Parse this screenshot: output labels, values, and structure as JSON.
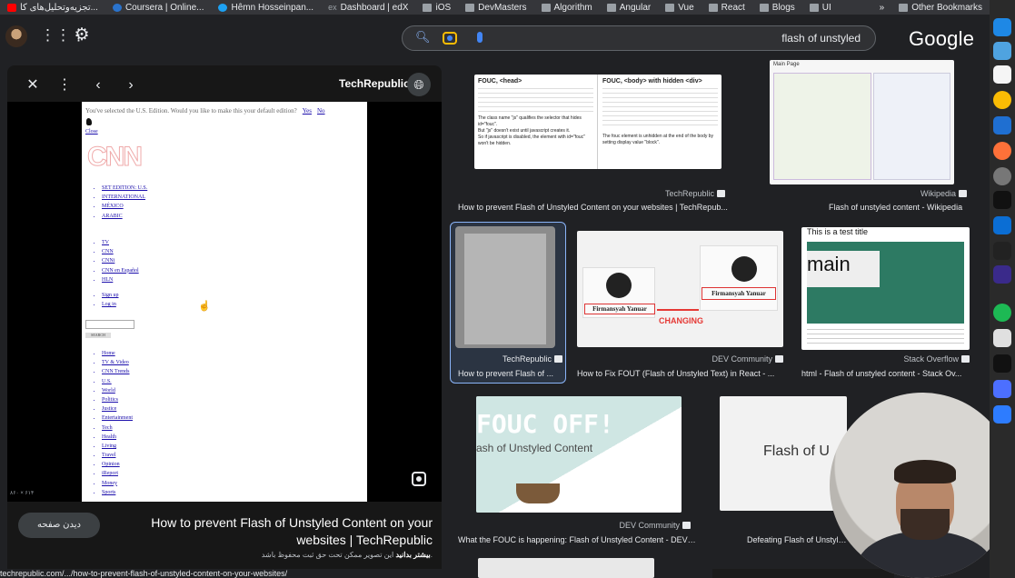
{
  "bookmarks": {
    "items": [
      {
        "label": "تجزیه‌وتحلیل‌های کا...",
        "icon": "youtube-icon"
      },
      {
        "label": "Coursera | Online...",
        "icon": "coursera-icon"
      },
      {
        "label": "Hêmn Hosseinpan...",
        "icon": "twitter-icon"
      },
      {
        "label": "Dashboard | edX",
        "icon": "edx-icon"
      },
      {
        "label": "iOS",
        "icon": "folder-icon"
      },
      {
        "label": "DevMasters",
        "icon": "folder-icon"
      },
      {
        "label": "Algorithm",
        "icon": "folder-icon"
      },
      {
        "label": "Angular",
        "icon": "folder-icon"
      },
      {
        "label": "Vue",
        "icon": "folder-icon"
      },
      {
        "label": "React",
        "icon": "folder-icon"
      },
      {
        "label": "Blogs",
        "icon": "folder-icon"
      },
      {
        "label": "UI",
        "icon": "folder-icon"
      }
    ],
    "overflow": "»",
    "other": "Other Bookmarks"
  },
  "header": {
    "query": "flash of unstyled",
    "logo": "Google"
  },
  "viewer": {
    "source": "TechRepublic",
    "dims": "۸۶۰ × ۶۱۴",
    "visit": "دیدن صفحه",
    "title": "How to prevent Flash of Unstyled Content on your websites | TechRepublic",
    "copyright_text": "این تصویر ممکن تحت حق ثبت محفوظ باشد.",
    "copyright_link": "بیشتر بدانید",
    "url": "techrepublic.com/.../how-to-prevent-flash-of-unstyled-content-on-your-websites/"
  },
  "preview_page": {
    "notice": "You've selected the U.S. Edition. Would you like to make this your default edition?",
    "yes": "Yes",
    "no": "No",
    "close": "Close",
    "logo": "CNN",
    "editions": [
      "SET EDITION: U.S.",
      "INTERNATIONAL",
      "MÉXICO",
      "ARABIC"
    ],
    "channels": [
      "TV",
      "CNN",
      "CNNi",
      "CNN en Español",
      "HLN"
    ],
    "account": [
      "Sign up",
      "Log in"
    ],
    "search_button": "SEARCH",
    "sections": [
      "Home",
      "TV & Video",
      "CNN Trends",
      "U.S.",
      "World",
      "Politics",
      "Justice",
      "Entertainment",
      "Tech",
      "Health",
      "Living",
      "Travel",
      "Opinion",
      "iReport",
      "Money",
      "Sports"
    ]
  },
  "results": [
    {
      "source": "TechRepublic",
      "title": "How to prevent Flash of Unstyled Content on your websites | TechRepub..."
    },
    {
      "source": "Wikipedia",
      "title": "Flash of unstyled content - Wikipedia"
    },
    {
      "source": "TechRepublic",
      "title": "How to prevent Flash of ..."
    },
    {
      "source": "DEV Community",
      "title": "How to Fix FOUT (Flash of Unstyled Text) in React - ..."
    },
    {
      "source": "Stack Overflow",
      "title": "html - Flash of unstyled content - Stack Ov..."
    },
    {
      "source": "DEV Community",
      "title": "What the FOUC is happening: Flash of Unstyled Content - DEV ..."
    },
    {
      "source": "",
      "title": "Defeating Flash of Unstyled"
    }
  ],
  "thumb_text": {
    "fouc_head": "FOUC, <head>",
    "fouc_body": "FOUC, <body> with hidden <div>",
    "bullets_left": [
      "The class name \"js\" qualifies the selector that hides id=\"fouc\".",
      "But \"js\" doesn't exist until javascript creates it.",
      "So if javascript is disabled, the element with id=\"fouc\" won't be hidden."
    ],
    "bullet_right": "The fouc element is unhidden at the end of the body by setting display value \"block\".",
    "wiki_header": "Main Page",
    "fout_name": "Firmansyah Yanuar",
    "fout_changing": "CHANGING",
    "so_title": "This is a test title",
    "so_main": "main",
    "fouc_off": "FOUC OFF!",
    "fouc_off_sub": "ash of Unstyled Content",
    "defeat_text": "Flash of U"
  }
}
